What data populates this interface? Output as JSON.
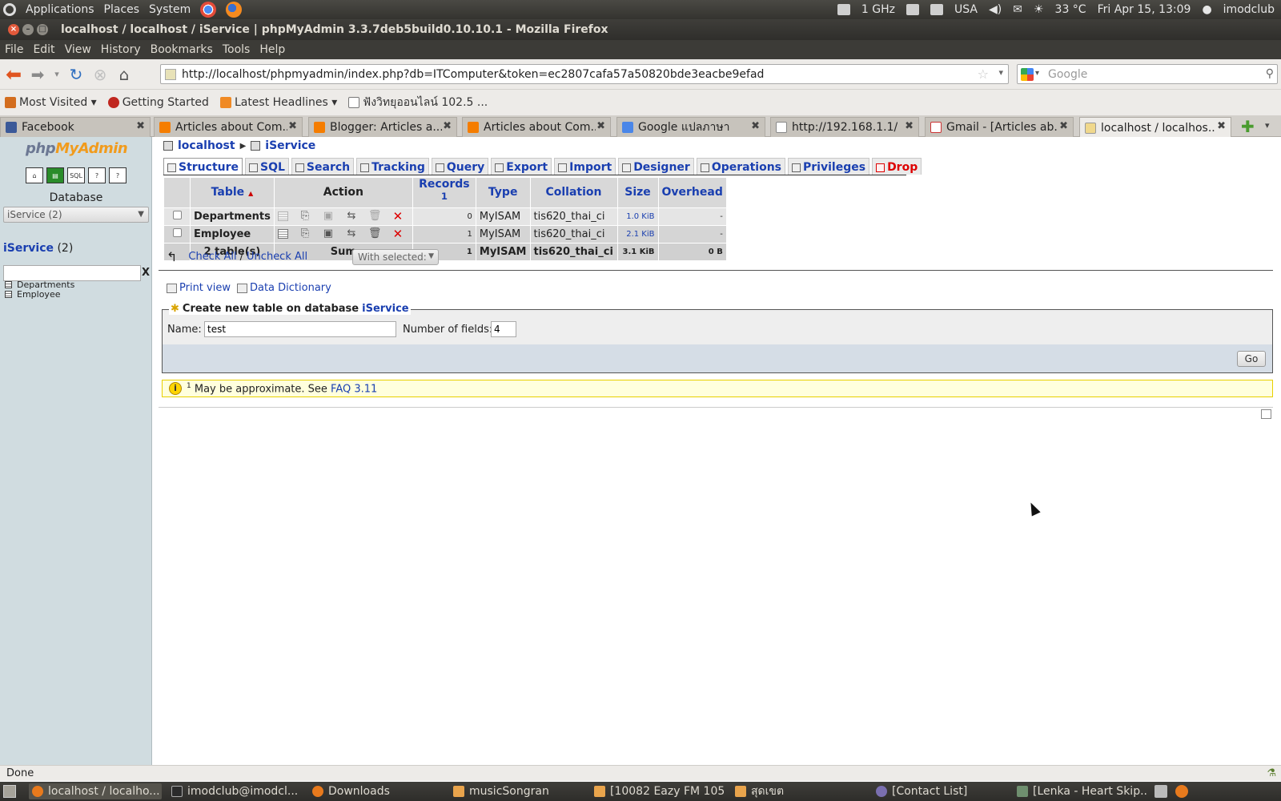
{
  "top_panel": {
    "menus": [
      "Applications",
      "Places",
      "System"
    ],
    "cpu": "1 GHz",
    "keyboard": "USA",
    "weather": "33 °C",
    "clock": "Fri Apr 15, 13:09",
    "user": "imodclub"
  },
  "window": {
    "title": "localhost / localhost / iService | phpMyAdmin 3.3.7deb5build0.10.10.1 - Mozilla Firefox"
  },
  "menubar": [
    "File",
    "Edit",
    "View",
    "History",
    "Bookmarks",
    "Tools",
    "Help"
  ],
  "navbar": {
    "url": "http://localhost/phpmyadmin/index.php?db=ITComputer&token=ec2807cafa57a50820bde3eacbe9efad",
    "search_placeholder": "Google"
  },
  "bookmarks": [
    {
      "label": "Most Visited ▾",
      "icon": "most-visited-icon"
    },
    {
      "label": "Getting Started",
      "icon": "getting-started-icon"
    },
    {
      "label": "Latest Headlines ▾",
      "icon": "rss-icon"
    },
    {
      "label": "ฟังวิทยุออนไลน์ 102.5 ...",
      "icon": "radio-icon"
    }
  ],
  "tabs": [
    {
      "label": "Facebook",
      "icon": "fb"
    },
    {
      "label": "Articles about Com...",
      "icon": "blogger"
    },
    {
      "label": "Blogger: Articles a...",
      "icon": "blogger"
    },
    {
      "label": "Articles about Com...",
      "icon": "blogger"
    },
    {
      "label": "Google แปลภาษา",
      "icon": "gt"
    },
    {
      "label": "http://192.168.1.1/",
      "icon": "web"
    },
    {
      "label": "Gmail - [Articles ab...",
      "icon": "gmail"
    },
    {
      "label": "localhost / localhos...",
      "icon": "pma"
    }
  ],
  "sidebar": {
    "logo_php": "php",
    "logo_my": "MyAdmin",
    "database_label": "Database",
    "database_select": "iService (2)",
    "db_name": "iService",
    "db_count": "(2)",
    "filter_clear": "X",
    "tables": [
      "Departments",
      "Employee"
    ]
  },
  "breadcrumb": {
    "server": "localhost",
    "database": "iService"
  },
  "page_tabs": [
    {
      "label": "Structure",
      "icon": "structure-icon",
      "active": true
    },
    {
      "label": "SQL",
      "icon": "sql-icon"
    },
    {
      "label": "Search",
      "icon": "search-icon"
    },
    {
      "label": "Tracking",
      "icon": "tracking-icon"
    },
    {
      "label": "Query",
      "icon": "query-icon"
    },
    {
      "label": "Export",
      "icon": "export-icon"
    },
    {
      "label": "Import",
      "icon": "import-icon"
    },
    {
      "label": "Designer",
      "icon": "designer-icon"
    },
    {
      "label": "Operations",
      "icon": "operations-icon"
    },
    {
      "label": "Privileges",
      "icon": "privileges-icon"
    },
    {
      "label": "Drop",
      "icon": "drop-icon"
    }
  ],
  "table": {
    "headers": {
      "table": "Table",
      "sort_marker": "▲",
      "action": "Action",
      "records": "Records",
      "records_sup": "1",
      "type": "Type",
      "collation": "Collation",
      "size": "Size",
      "overhead": "Overhead"
    },
    "rows": [
      {
        "name": "Departments",
        "records": "0",
        "type": "MyISAM",
        "collation": "tis620_thai_ci",
        "size": "1.0 KiB",
        "overhead": "-"
      },
      {
        "name": "Employee",
        "records": "1",
        "type": "MyISAM",
        "collation": "tis620_thai_ci",
        "size": "2.1 KiB",
        "overhead": "-"
      }
    ],
    "summary": {
      "count": "2 table(s)",
      "label": "Sum",
      "records": "1",
      "type": "MyISAM",
      "collation": "tis620_thai_ci",
      "size": "3.1 KiB",
      "overhead": "0 B"
    }
  },
  "check_row": {
    "check_all": "Check All",
    "separator": "/",
    "uncheck_all": "Uncheck All",
    "with_selected": "With selected:"
  },
  "links": {
    "print_view": "Print view",
    "data_dictionary": "Data Dictionary"
  },
  "create_table": {
    "legend": "Create new table on database",
    "legend_db": "iService",
    "name_label": "Name:",
    "name_value": "test",
    "fields_label": "Number of fields:",
    "fields_value": "4",
    "go": "Go"
  },
  "notice": {
    "sup": "1",
    "text": "May be approximate. See",
    "link": "FAQ 3.11"
  },
  "status": "Done",
  "taskbar": [
    {
      "label": "localhost / localho...",
      "icon": "ff",
      "active": true
    },
    {
      "label": "imodclub@imodcl...",
      "icon": "term"
    },
    {
      "label": "Downloads",
      "icon": "ff"
    },
    {
      "label": "musicSongran",
      "icon": "folder"
    },
    {
      "label": "[10082 Eazy FM 105...",
      "icon": "folder"
    },
    {
      "label": "สุดเขต",
      "icon": "folder"
    },
    {
      "label": "[Contact List]",
      "icon": "pidgin"
    },
    {
      "label": "[Lenka - Heart Skip...",
      "icon": "music"
    }
  ]
}
